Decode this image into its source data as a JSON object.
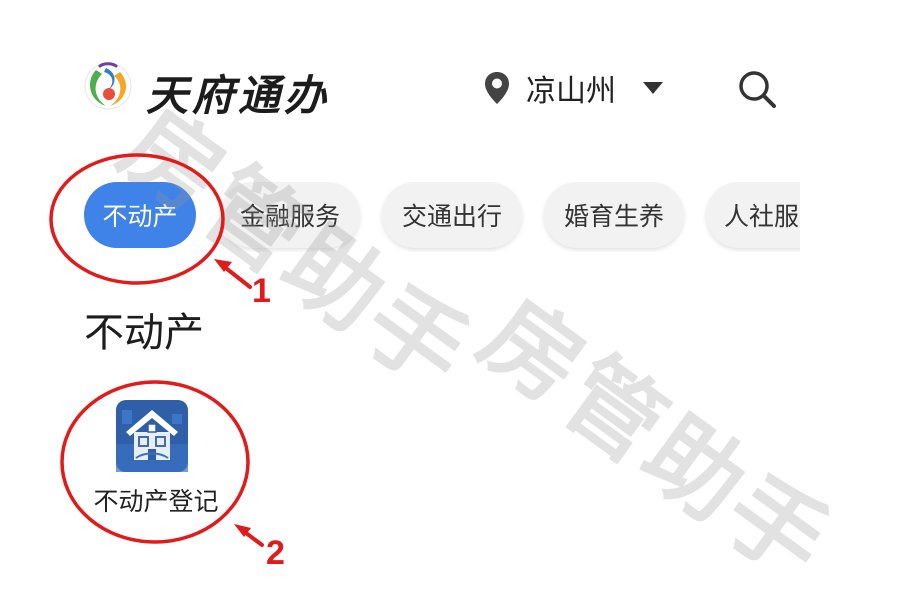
{
  "header": {
    "app_title": "天府通办",
    "location": "凉山州",
    "logo_icon": "tianfu-logo-icon",
    "location_icon": "location-pin-icon",
    "dropdown_icon": "caret-down-icon",
    "search_icon": "search-icon"
  },
  "tabs": [
    {
      "label": "不动产",
      "active": true
    },
    {
      "label": "金融服务",
      "active": false
    },
    {
      "label": "交通出行",
      "active": false
    },
    {
      "label": "婚育生养",
      "active": false
    },
    {
      "label": "人社服",
      "active": false
    }
  ],
  "section": {
    "title": "不动产",
    "items": [
      {
        "label": "不动产登记",
        "icon": "house-registration-icon"
      }
    ]
  },
  "annotations": {
    "step1": "1",
    "step2": "2",
    "color": "#e11a1a"
  },
  "watermark": "房管助手",
  "colors": {
    "accent": "#3f82e8",
    "tab_bg": "#f2f2f2",
    "annotation": "#e11a1a"
  }
}
